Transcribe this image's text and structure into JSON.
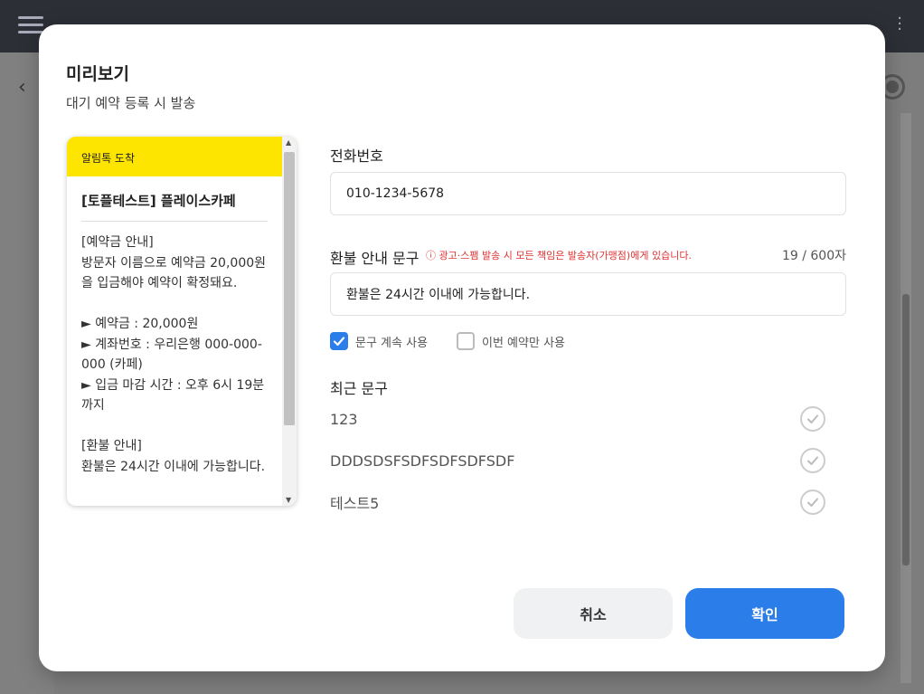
{
  "modal": {
    "title": "미리보기",
    "subtitle": "대기 예약 등록 시 발송"
  },
  "preview": {
    "header": "알림톡 도착",
    "business": "[토플테스트] 플레이스카페",
    "message": "[예약금 안내]\n방문자 이름으로 예약금 20,000원을 입금해야 예약이 확정돼요.\n\n► 예약금 : 20,000원\n► 계좌번호 : 우리은행 000-000-000 (카페)\n► 입금 마감 시간 : 오후 6시 19분까지\n\n[환불 안내]\n환불은 24시간 이내에 가능합니다."
  },
  "form": {
    "phone_label": "전화번호",
    "phone_value": "010-1234-5678",
    "refund_label": "환불 안내 문구",
    "warning": "ⓘ 광고·스팸 발송 시 모든 책임은 발송자(가맹점)에게 있습니다.",
    "counter": "19 / 600자",
    "refund_value": "환불은 24시간 이내에 가능합니다.",
    "keep_label": "문구 계속 사용",
    "keep_checked": true,
    "once_label": "이번 예약만 사용",
    "once_checked": false
  },
  "recent": {
    "title": "최근 문구",
    "items": [
      "123",
      "DDDSDSFSDFSDFSDFSDF",
      "테스트5"
    ]
  },
  "buttons": {
    "cancel": "취소",
    "confirm": "확인"
  },
  "colors": {
    "accent": "#2b7de9",
    "kakao_yellow": "#fee500",
    "warning": "#e03131"
  }
}
